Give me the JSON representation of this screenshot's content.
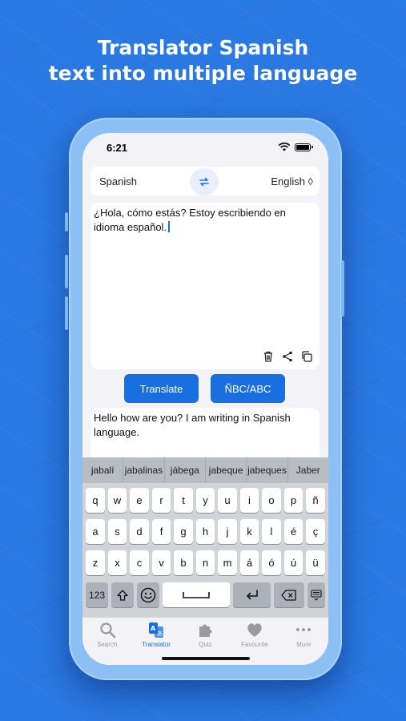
{
  "headline": {
    "line1": "Translator Spanish",
    "line2": "text into multiple language"
  },
  "status": {
    "time": "6:21"
  },
  "language": {
    "from": "Spanish",
    "to": "English ◊"
  },
  "input": {
    "text": "¿Hola, cómo estás? Estoy escribiendo en idioma español."
  },
  "buttons": {
    "translate": "Translate",
    "keyboard_switch": "ÑBC/ABC"
  },
  "output": {
    "text": "Hello how are you? I am writing in Spanish language."
  },
  "keyboard": {
    "suggestions": [
      "jabalí",
      "jabalinas",
      "jábega",
      "jabeque",
      "jabeques",
      "Jaber"
    ],
    "row1": [
      "q",
      "w",
      "e",
      "r",
      "t",
      "y",
      "u",
      "i",
      "o",
      "p",
      "ñ"
    ],
    "row2": [
      "a",
      "s",
      "d",
      "f",
      "g",
      "h",
      "j",
      "k",
      "l",
      "é",
      "ç"
    ],
    "row3": [
      "z",
      "x",
      "c",
      "v",
      "b",
      "n",
      "m",
      "á",
      "ó",
      "ú",
      "ü"
    ],
    "numbers_key": "123"
  },
  "tabs": [
    {
      "label": "Search",
      "icon": "search-icon"
    },
    {
      "label": "Translator",
      "icon": "translate-icon",
      "active": true
    },
    {
      "label": "Quiz",
      "icon": "puzzle-icon"
    },
    {
      "label": "Favourite",
      "icon": "heart-icon"
    },
    {
      "label": "More",
      "icon": "more-icon"
    }
  ],
  "colors": {
    "background": "#2a79e3",
    "accent": "#1a6fe0",
    "phone_frame": "#8cc0f5"
  }
}
